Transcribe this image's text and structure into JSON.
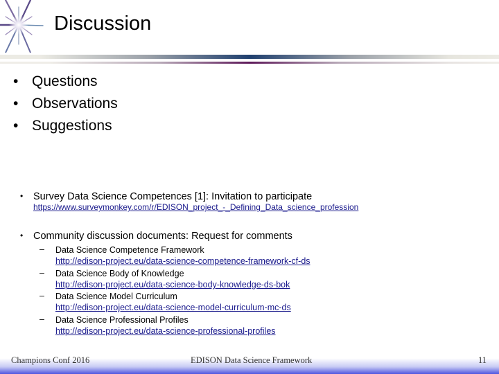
{
  "slide": {
    "title": "Discussion",
    "main_bullets": [
      "Questions",
      "Observations",
      "Suggestions"
    ],
    "sections": [
      {
        "text": "Survey Data Science Competences [1]: Invitation to participate",
        "url": "https://www.surveymonkey.com/r/EDISON_project_-_Defining_Data_science_profession"
      },
      {
        "text": "Community discussion documents: Request for comments",
        "sub_items": [
          {
            "text": "Data Science Competence Framework",
            "url": "http://edison-project.eu/data-science-competence-framework-cf-ds"
          },
          {
            "text": "Data Science Body of Knowledge",
            "url": "http://edison-project.eu/data-science-body-knowledge-ds-bok"
          },
          {
            "text": "Data Science Model Curriculum",
            "url": "http://edison-project.eu/data-science-model-curriculum-mc-ds"
          },
          {
            "text": "Data Science Professional Profiles",
            "url": "http://edison-project.eu/data-science-professional-profiles"
          }
        ]
      }
    ],
    "bullet_glyph": "•",
    "dash_glyph": "–"
  },
  "footer": {
    "left": "Champions Conf 2016",
    "center": "EDISON Data Science Framework",
    "page_number": "11"
  },
  "colors": {
    "link": "#1a1a8c",
    "header_bar_center": "#1f3f6e",
    "header_bar2_center": "#5e1a5a",
    "footer_gradient": "#4f55e0"
  },
  "icons": {
    "logo": "starburst-icon"
  }
}
